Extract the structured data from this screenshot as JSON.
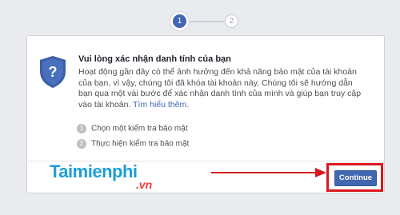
{
  "stepper": {
    "steps": [
      {
        "number": "1",
        "state": "active"
      },
      {
        "number": "2",
        "state": "inactive"
      }
    ]
  },
  "card": {
    "title": "Vui lòng xác nhận danh tính của bạn",
    "body": "Hoạt động gần đây có thể ảnh hưởng đến khả năng bảo mật của tài khoản của bạn, vì vậy, chúng tôi đã khóa tài khoản này. Chúng tôi sẽ hướng dẫn bạn qua một vài bước để xác nhận danh tính của mình và giúp bạn truy cập vào tài khoản.",
    "learn_more": "Tìm hiểu thêm.",
    "options": [
      {
        "number": "1",
        "label": "Chọn một kiểm tra bảo mật"
      },
      {
        "number": "2",
        "label": "Thực hiện kiểm tra bảo mật"
      }
    ],
    "continue_label": "Continue"
  },
  "watermark": {
    "brand": "Taimienphi",
    "tld": ".vn"
  },
  "colors": {
    "accent": "#4267b2",
    "highlight": "#d9181f",
    "shield": "#3b5ea8"
  },
  "icons": {
    "shield": "shield-question-icon",
    "arrow": "arrow-right-icon"
  }
}
